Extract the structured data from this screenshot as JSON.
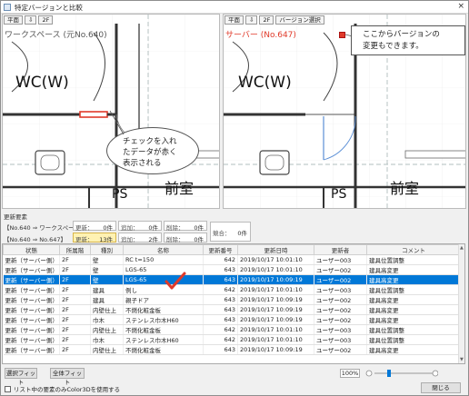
{
  "window": {
    "title": "特定バージョンと比較",
    "close_glyph": "×"
  },
  "left_pane": {
    "toolbar": [
      "平面",
      "⇩",
      "2F"
    ],
    "label": "ワークスペース (元No.640)",
    "rooms": {
      "wc": "WC(W)",
      "ps": "PS",
      "front": "前室"
    }
  },
  "right_pane": {
    "toolbar": [
      "平面",
      "⇩",
      "2F",
      "バージョン選択"
    ],
    "label": "サーバー (No.647)",
    "rooms": {
      "wc": "WC(W)",
      "ps": "PS",
      "front": "前室"
    }
  },
  "callouts": {
    "red_note": "チェックを入れ\nたデータが赤く\n表示される",
    "version_note": "ここからバージョンの\n変更もできます。"
  },
  "section_label": "更新要素",
  "summary": [
    {
      "name": "【No.640 ⇒ ワークスペース】",
      "updated_label": "更新：",
      "updated": "0件",
      "added_label": "追加：",
      "added": "0件",
      "deleted_label": "削除：",
      "deleted": "0件"
    },
    {
      "name": "【No.640 ⇒ No.647】",
      "updated_label": "更新：",
      "updated": "13件",
      "added_label": "追加：",
      "added": "2件",
      "deleted_label": "削除：",
      "deleted": "0件"
    }
  ],
  "overlap": {
    "label": "競合：",
    "value": "0件"
  },
  "table": {
    "columns": [
      "状態",
      "所属階",
      "種別",
      "名称",
      "更新番号",
      "更新日時",
      "更新者",
      "コメント"
    ],
    "rows": [
      [
        "更新（サーバー側）",
        "2F",
        "壁",
        "RC t=150",
        "642",
        "2019/10/17 10:01:10",
        "ユーザー003",
        "建具位置調整"
      ],
      [
        "更新（サーバー側）",
        "2F",
        "壁",
        "LGS-65",
        "643",
        "2019/10/17 10:01:10",
        "ユーザー002",
        "建具高変更"
      ],
      [
        "更新（サーバー側）",
        "2F",
        "壁",
        "LGS-65",
        "643",
        "2019/10/17 10:09:19",
        "ユーザー002",
        "建具高変更"
      ],
      [
        "更新（サーバー側）",
        "2F",
        "建具",
        "例し",
        "642",
        "2019/10/17 10:01:10",
        "ユーザー003",
        "建具位置調整"
      ],
      [
        "更新（サーバー側）",
        "2F",
        "建具",
        "親子ドア",
        "643",
        "2019/10/17 10:09:19",
        "ユーザー002",
        "建具高変更"
      ],
      [
        "更新（サーバー側）",
        "2F",
        "内壁仕上",
        "不燃化粧金板",
        "643",
        "2019/10/17 10:09:19",
        "ユーザー002",
        "建具高変更"
      ],
      [
        "更新（サーバー側）",
        "2F",
        "巾木",
        "ステンレス巾木H60",
        "643",
        "2019/10/17 10:09:19",
        "ユーザー002",
        "建具高変更"
      ],
      [
        "更新（サーバー側）",
        "2F",
        "内壁仕上",
        "不燃化粧金板",
        "642",
        "2019/10/17 10:01:10",
        "ユーザー003",
        "建具位置調整"
      ],
      [
        "更新（サーバー側）",
        "2F",
        "巾木",
        "ステンレス巾木H60",
        "642",
        "2019/10/17 10:01:10",
        "ユーザー003",
        "建具位置調整"
      ],
      [
        "更新（サーバー側）",
        "2F",
        "内壁仕上",
        "不燃化粧金板",
        "643",
        "2019/10/17 10:09:19",
        "ユーザー002",
        "建具高変更"
      ]
    ],
    "selected_row": 2
  },
  "buttons": {
    "select_fit": "選択フィット",
    "all_fit": "全体フィット",
    "close": "閉じる"
  },
  "zoom": "100%",
  "checkbox_label": "リスト中の要素のみColor3Dを使用する",
  "colors": {
    "highlight_red": "#e03a2a",
    "selection_blue": "#0078d7"
  }
}
